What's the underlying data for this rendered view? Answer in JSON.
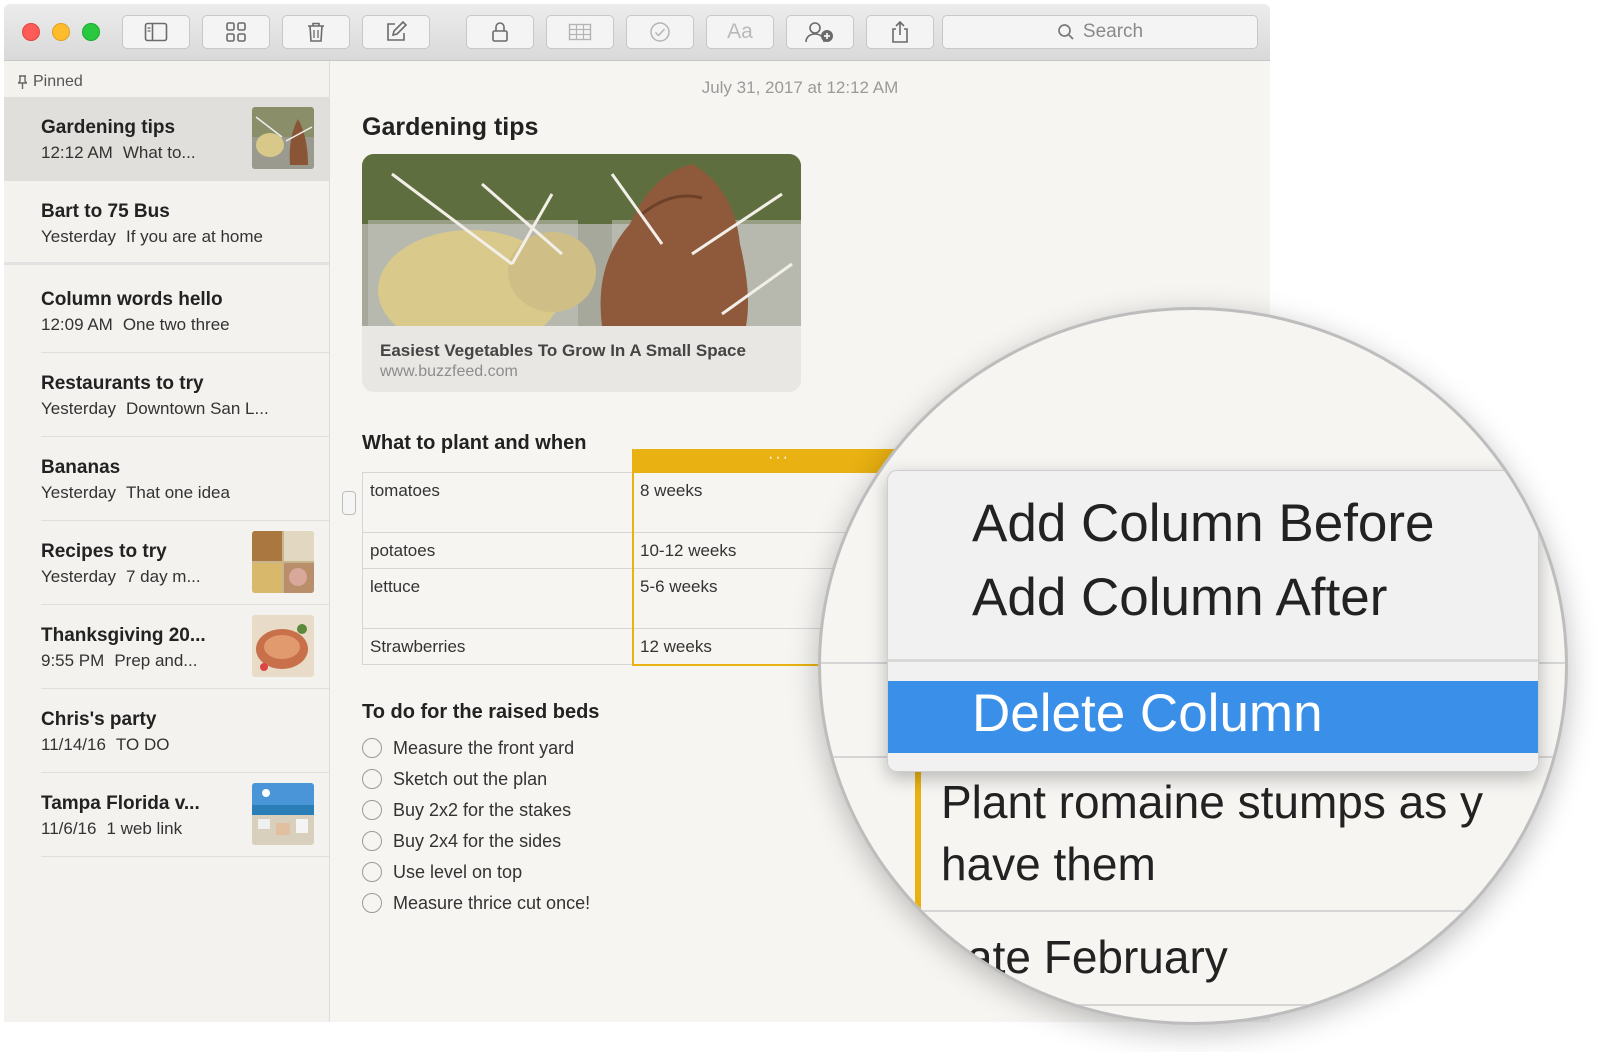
{
  "toolbar": {
    "format_button_label": "Aa",
    "search_placeholder": "Search"
  },
  "sidebar": {
    "pinned_label": "Pinned",
    "notes": [
      {
        "title": "Gardening tips",
        "date": "12:12 AM",
        "preview": "What to..."
      },
      {
        "title": "Bart to 75 Bus",
        "date": "Yesterday",
        "preview": "If you are at home"
      },
      {
        "title": "Column words hello",
        "date": "12:09 AM",
        "preview": "One two three"
      },
      {
        "title": "Restaurants to try",
        "date": "Yesterday",
        "preview": "Downtown San L..."
      },
      {
        "title": "Bananas",
        "date": "Yesterday",
        "preview": "That one idea"
      },
      {
        "title": "Recipes to try",
        "date": "Yesterday",
        "preview": "7 day m..."
      },
      {
        "title": "Thanksgiving 20...",
        "date": "9:55 PM",
        "preview": "Prep and..."
      },
      {
        "title": "Chris's party",
        "date": "11/14/16",
        "preview": "TO DO"
      },
      {
        "title": "Tampa Florida v...",
        "date": "11/6/16",
        "preview": "1 web link"
      }
    ]
  },
  "note": {
    "date": "July 31, 2017 at 12:12 AM",
    "title": "Gardening tips",
    "link": {
      "title": "Easiest Vegetables To Grow In A Small Space",
      "url": "www.buzzfeed.com"
    },
    "table_heading": "What to plant and when",
    "table": [
      [
        "tomatoes",
        "8 weeks"
      ],
      [
        "potatoes",
        "10-12 weeks"
      ],
      [
        "lettuce",
        "5-6 weeks"
      ],
      [
        "Strawberries",
        "12 weeks"
      ]
    ],
    "column_handle": "···",
    "checklist_heading": "To do for the raised beds",
    "checklist": [
      "Measure the front yard",
      "Sketch out the plan",
      "Buy 2x2 for the stakes",
      "Buy 2x4 for the sides",
      "Use level on top",
      "Measure thrice cut once!"
    ]
  },
  "context_menu": {
    "items": [
      "Add Column Before",
      "Add Column After",
      "Delete Column"
    ],
    "highlighted": "Delete Column"
  },
  "magnified_table": {
    "line1": "Plant romaine stumps as y",
    "line2": "have them",
    "line3": "ate February"
  },
  "colors": {
    "accent_yellow": "#e9b111",
    "menu_highlight": "#3a8fe9",
    "selected_note_bg": "#e1dfdc"
  }
}
